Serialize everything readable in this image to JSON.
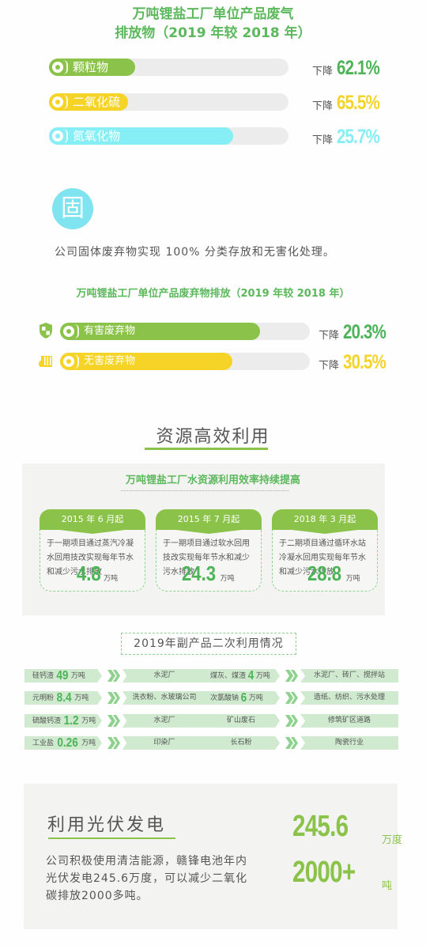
{
  "colors": {
    "green": "#8bc34a",
    "dark_green": "#4cb356",
    "yellow": "#f5d327",
    "cyan": "#86eef5",
    "track": "#ececec"
  },
  "gas_section": {
    "title_line1": "万吨锂盐工厂单位产品废气",
    "title_line2": "排放物（2019 年较 2018 年）",
    "items": [
      {
        "label": "颗粒物",
        "drop_label": "下降",
        "value": "62.1%",
        "color": "#8bc34a",
        "value_color": "#4cb356",
        "fill_fraction": 0.36
      },
      {
        "label": "二氧化硫",
        "drop_label": "下降",
        "value": "65.5%",
        "color": "#f5d327",
        "value_color": "#f5d327",
        "fill_fraction": 0.33
      },
      {
        "label": "氮氧化物",
        "drop_label": "下降",
        "value": "25.7%",
        "color": "#86eef5",
        "value_color": "#86eef5",
        "fill_fraction": 0.77
      }
    ]
  },
  "solid_section": {
    "icon_char": "固",
    "description": "公司固体废弃物实现 100% 分类存放和无害化处理。",
    "title": "万吨锂盐工厂单位产品废弃物排放（2019 年较 2018 年）",
    "items": [
      {
        "icon": "shield-icon",
        "label": "有害废弃物",
        "drop_label": "下降",
        "value": "20.3%",
        "color": "#8bc34a",
        "value_color": "#4cb356",
        "fill_fraction": 0.8
      },
      {
        "icon": "trash-bin-icon",
        "label": "无害废弃物",
        "drop_label": "下降",
        "value": "30.5%",
        "color": "#f5d327",
        "value_color": "#f5d327",
        "fill_fraction": 0.69
      }
    ]
  },
  "resource_section": {
    "title": "资源高效利用",
    "water": {
      "title": "万吨锂盐工厂水资源利用效率持续提高",
      "cards": [
        {
          "date": "2015 年 6 月起",
          "text": "于一期项目通过蒸汽冷凝水回用技改实现每年节水和减少污水排放",
          "value": "4.8",
          "unit": "万吨"
        },
        {
          "date": "2015 年 7 月起",
          "text": "于一期项目通过软水回用技改实现每年节水和减少污水排放",
          "value": "24.3",
          "unit": "万吨"
        },
        {
          "date": "2018 年 3 月起",
          "text": "于二期项目通过循环水站冷凝水回用实现每年节水和减少污水排放",
          "value": "28.8",
          "unit": "万吨"
        }
      ]
    },
    "byproducts": {
      "title": "2019年副产品二次利用情况",
      "left": [
        {
          "name": "硅钙渣",
          "value": "49",
          "unit": "万吨",
          "use": "水泥厂"
        },
        {
          "name": "元明粉",
          "value": "8.4",
          "unit": "万吨",
          "use": "洗衣粉、水玻璃公司"
        },
        {
          "name": "硫酸钙渣",
          "value": "1.2",
          "unit": "万吨",
          "use": "水泥厂"
        },
        {
          "name": "工业盐",
          "value": "0.26",
          "unit": "万吨",
          "use": "印染厂"
        }
      ],
      "right": [
        {
          "name": "煤灰、煤渣",
          "value": "4",
          "unit": "万吨",
          "use": "水泥厂、砖厂、搅拌站"
        },
        {
          "name": "次氯酸钠",
          "value": "6",
          "unit": "万吨",
          "use": "造纸、纺织、污水处理"
        },
        {
          "name": "矿山废石",
          "value": "",
          "unit": "",
          "use": "修筑矿区道路"
        },
        {
          "name": "长石粉",
          "value": "",
          "unit": "",
          "use": "陶瓷行业"
        }
      ]
    }
  },
  "pv_section": {
    "title": "利用光伏发电",
    "description": "公司积极使用清洁能源，赣锋电池年内光伏发电245.6万度，可以减少二氧化碳排放2000多吨。",
    "stats": [
      {
        "value": "245.6",
        "unit": "万度"
      },
      {
        "value": "2000+",
        "unit": "吨"
      }
    ]
  }
}
